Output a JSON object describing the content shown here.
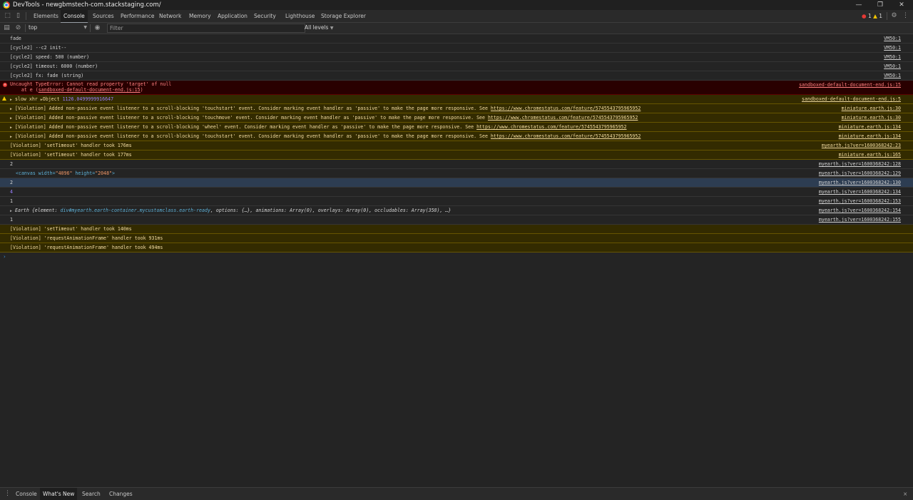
{
  "window": {
    "title": "DevTools - newgbmstech-com.stackstaging.com/"
  },
  "tabs": [
    "Elements",
    "Console",
    "Sources",
    "Performance",
    "Network",
    "Memory",
    "Application",
    "Security",
    "Lighthouse",
    "Storage Explorer"
  ],
  "badges": {
    "errors": "1",
    "warnings": "1"
  },
  "console_toolbar": {
    "context": "top",
    "filter_placeholder": "Filter",
    "levels": "All levels"
  },
  "messages": [
    {
      "type": "log",
      "text": "fade",
      "source": "VM50:1"
    },
    {
      "type": "log",
      "text": "[cycle2] --c2 init--",
      "source": "VM50:1"
    },
    {
      "type": "log",
      "text": "[cycle2] speed: 500 (number)",
      "source": "VM50:1"
    },
    {
      "type": "log",
      "text": "[cycle2] timeout: 6000 (number)",
      "source": "VM50:1"
    },
    {
      "type": "log",
      "text": "[cycle2] fx: fade (string)",
      "source": "VM50:1"
    },
    {
      "type": "error",
      "text": "Uncaught TypeError: Cannot read property 'target' of null",
      "text2_prefix": "    at e (",
      "text2_link": "sandboxed-default-document-end.js:15",
      "text2_suffix": ")",
      "source": "sandboxed-default-document-end.js:15"
    },
    {
      "type": "warn",
      "text": "slow xhr",
      "object_label": "Object",
      "object_value": "1126.0499999916647",
      "source": "sandboxed-default-document-end.js:5"
    },
    {
      "type": "warn-violation",
      "text": "[Violation] Added non-passive event listener to a scroll-blocking 'touchstart' event. Consider marking event handler as 'passive' to make the page more responsive. See ",
      "link": "https://www.chromestatus.com/feature/5745543795965952",
      "source": "miniature.earth.js:30"
    },
    {
      "type": "warn-violation",
      "text": "[Violation] Added non-passive event listener to a scroll-blocking 'touchmove' event. Consider marking event handler as 'passive' to make the page more responsive. See ",
      "link": "https://www.chromestatus.com/feature/5745543795965952",
      "source": "miniature.earth.js:30"
    },
    {
      "type": "warn-violation",
      "text": "[Violation] Added non-passive event listener to a scroll-blocking 'wheel' event. Consider marking event handler as 'passive' to make the page more responsive. See ",
      "link": "https://www.chromestatus.com/feature/5745543795965952",
      "source": "miniature.earth.js:134"
    },
    {
      "type": "warn-violation",
      "text": "[Violation] Added non-passive event listener to a scroll-blocking 'touchstart' event. Consider marking event handler as 'passive' to make the page more responsive. See ",
      "link": "https://www.chromestatus.com/feature/5745543795965952",
      "source": "miniature.earth.js:134"
    },
    {
      "type": "warn-plain",
      "text": "[Violation] 'setTimeout' handler took 176ms",
      "source": "myearth.js?ver=1600368242:23"
    },
    {
      "type": "warn-plain",
      "text": "[Violation] 'setTimeout' handler took 177ms",
      "source": "miniature.earth.js:165"
    },
    {
      "type": "log",
      "text": "2",
      "source": "myearth.js?ver=1600368242:128"
    },
    {
      "type": "canvas",
      "tag_open": "<canvas ",
      "attr1": "width=",
      "val1": "\"4096\"",
      "attr2": " height=",
      "val2": "\"2048\"",
      "tag_close": ">",
      "source": "myearth.js?ver=1600368242:129"
    },
    {
      "type": "selected",
      "text": "2",
      "source": "myearth.js?ver=1600368242:130"
    },
    {
      "type": "number",
      "text": "4",
      "source": "myearth.js?ver=1600368242:134"
    },
    {
      "type": "log",
      "text": "1",
      "source": "myearth.js?ver=1600368242:153"
    },
    {
      "type": "object",
      "prefix": "Earth {element: ",
      "accent": "div#myearth.earth-container.mycustomclass.earth-ready",
      "suffix": ", options: {…}, animations: Array(0), overlays: Array(0), occludables: Array(358), …}",
      "source": "myearth.js?ver=1600368242:154"
    },
    {
      "type": "log",
      "text": "1",
      "source": "myearth.js?ver=1600368242:155"
    },
    {
      "type": "warn-plain",
      "text": "[Violation] 'setTimeout' handler took 140ms",
      "source": ""
    },
    {
      "type": "warn-plain",
      "text": "[Violation] 'requestAnimationFrame' handler took 931ms",
      "source": ""
    },
    {
      "type": "warn-plain",
      "text": "[Violation] 'requestAnimationFrame' handler took 494ms",
      "source": ""
    }
  ],
  "prompt_symbol": "›",
  "drawer_tabs": [
    "Console",
    "What's New",
    "Search",
    "Changes"
  ],
  "drawer_close": "×"
}
